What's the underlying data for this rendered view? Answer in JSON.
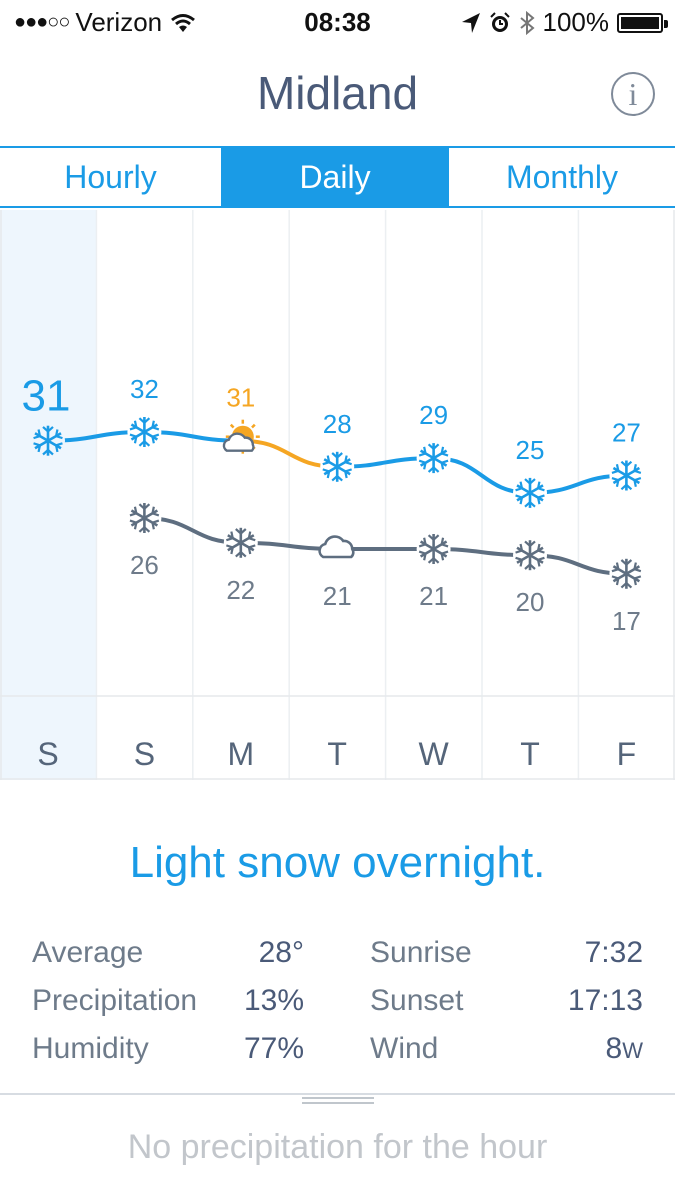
{
  "status_bar": {
    "carrier": "Verizon",
    "time": "08:38",
    "battery": "100%"
  },
  "header": {
    "title": "Midland",
    "info_icon": "info-icon"
  },
  "tabs": [
    {
      "label": "Hourly",
      "active": false
    },
    {
      "label": "Daily",
      "active": true
    },
    {
      "label": "Monthly",
      "active": false
    }
  ],
  "forecast": {
    "days": [
      "S",
      "S",
      "M",
      "T",
      "W",
      "T",
      "F"
    ],
    "highs": [
      31,
      32,
      31,
      28,
      29,
      25,
      27
    ],
    "lows": [
      26,
      22,
      21,
      21,
      20,
      17
    ],
    "high_icons": [
      "snowflake-icon",
      "snowflake-icon",
      "partly-sunny-icon",
      "snowflake-icon",
      "snowflake-icon",
      "snowflake-icon",
      "snowflake-icon"
    ],
    "low_icons": [
      "snowflake-icon",
      "snowflake-icon",
      "cloud-icon",
      "snowflake-icon",
      "snowflake-icon",
      "snowflake-icon"
    ],
    "selected_index": 0,
    "colors": {
      "high_line": "#1a9be6",
      "low_line": "#5e6e80",
      "highlight": "#f5a623",
      "selected_bg": "#eef6fd"
    }
  },
  "summary": "Light snow overnight.",
  "stats": {
    "left": [
      {
        "label": "Average",
        "value": "28°"
      },
      {
        "label": "Precipitation",
        "value": "13%"
      },
      {
        "label": "Humidity",
        "value": "77%"
      }
    ],
    "right": [
      {
        "label": "Sunrise",
        "value": "7:32"
      },
      {
        "label": "Sunset",
        "value": "17:13"
      },
      {
        "label": "Wind",
        "value": "8",
        "unit": "W"
      }
    ]
  },
  "bottom": {
    "message": "No precipitation for the hour"
  }
}
